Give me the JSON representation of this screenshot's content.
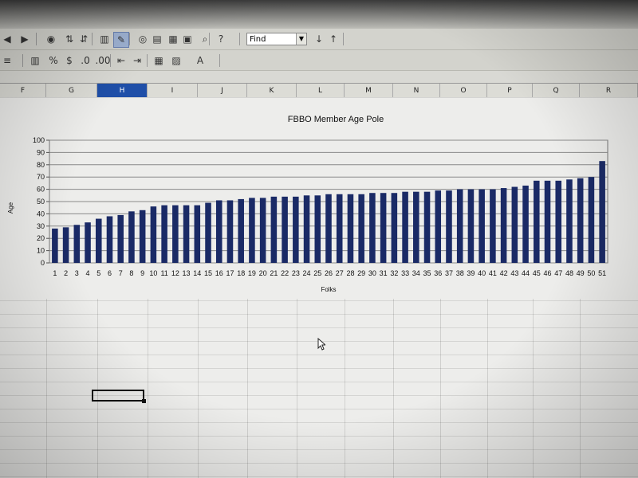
{
  "toolbar": {
    "find_label": "Find",
    "icons_row1": [
      "back-icon",
      "forward-icon",
      "navigator-icon",
      "sort-ascending-icon",
      "sort-descending-icon",
      "chart-icon",
      "draw-icon",
      "find-binoculars-icon",
      "gallery-icon",
      "datasource-icon",
      "database-icon",
      "zoom-icon",
      "help-icon",
      "find-next-icon",
      "find-previous-icon"
    ],
    "icons_row2": [
      "list-icon",
      "stock-chart-icon",
      "percent-icon",
      "number-format-icon",
      "decimal-add-icon",
      "decimal-remove-icon",
      "indent-decrease-icon",
      "indent-increase-icon",
      "borders-icon",
      "background-color-icon",
      "font-color-icon"
    ]
  },
  "columns": [
    "F",
    "G",
    "H",
    "I",
    "J",
    "K",
    "L",
    "M",
    "N",
    "O",
    "P",
    "Q",
    "R"
  ],
  "selected_column": "H",
  "chart_data": {
    "type": "bar",
    "title": "FBBO Member Age Pole",
    "xlabel": "Folks",
    "ylabel": "Age",
    "ylim": [
      0,
      100
    ],
    "yticks": [
      0,
      10,
      20,
      30,
      40,
      50,
      60,
      70,
      80,
      90,
      100
    ],
    "grid": "horizontal",
    "bar_color": "#1a2a66",
    "categories": [
      "1",
      "2",
      "3",
      "4",
      "5",
      "6",
      "7",
      "8",
      "9",
      "10",
      "11",
      "12",
      "13",
      "14",
      "15",
      "16",
      "17",
      "18",
      "19",
      "20",
      "21",
      "22",
      "23",
      "24",
      "25",
      "26",
      "27",
      "28",
      "29",
      "30",
      "31",
      "32",
      "33",
      "34",
      "35",
      "36",
      "37",
      "38",
      "39",
      "40",
      "41",
      "42",
      "43",
      "44",
      "45",
      "46",
      "47",
      "48",
      "49",
      "50",
      "51"
    ],
    "values": [
      28,
      29,
      31,
      33,
      36,
      38,
      39,
      42,
      43,
      46,
      47,
      47,
      47,
      47,
      49,
      51,
      51,
      52,
      53,
      53,
      54,
      54,
      54,
      55,
      55,
      56,
      56,
      56,
      56,
      57,
      57,
      57,
      58,
      58,
      58,
      59,
      59,
      60,
      60,
      60,
      60,
      61,
      62,
      63,
      67,
      67,
      67,
      68,
      69,
      70,
      83
    ]
  }
}
